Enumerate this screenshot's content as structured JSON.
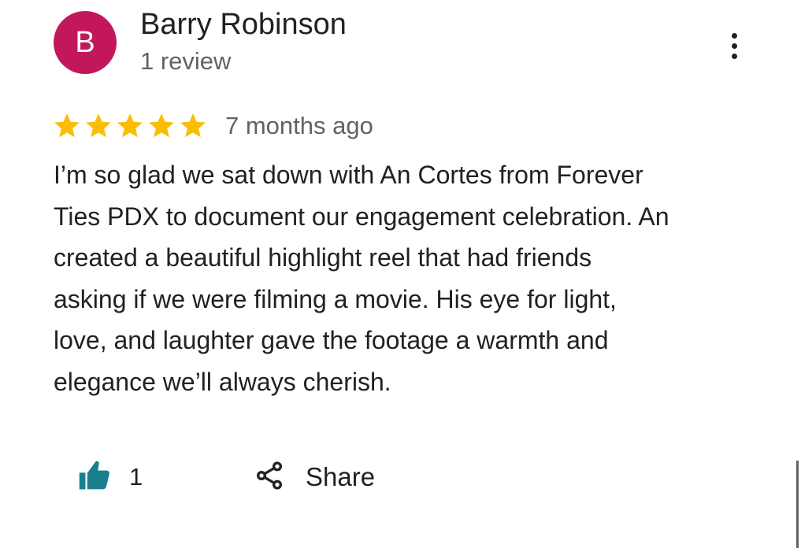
{
  "reviewer": {
    "initial": "B",
    "name": "Barry Robinson",
    "meta": "1 review",
    "avatar_color": "#c2185b"
  },
  "review": {
    "rating": 5,
    "star_color": "#fbbc04",
    "time_ago": "7 months ago",
    "text_lines": [
      "I’m so glad we sat down with An Cortes from Forever",
      "Ties PDX to document our engagement celebration. An",
      "created a beautiful highlight reel that had friends",
      "asking if we were filming a movie. His eye for light,",
      "love, and laughter gave the footage a warmth and",
      "elegance we’ll always cherish."
    ]
  },
  "actions": {
    "like_count": "1",
    "like_icon": "thumbs-up-icon",
    "like_color": "#1a7f8c",
    "share_label": "Share",
    "share_icon": "share-icon",
    "more_icon": "more-vert-icon"
  }
}
